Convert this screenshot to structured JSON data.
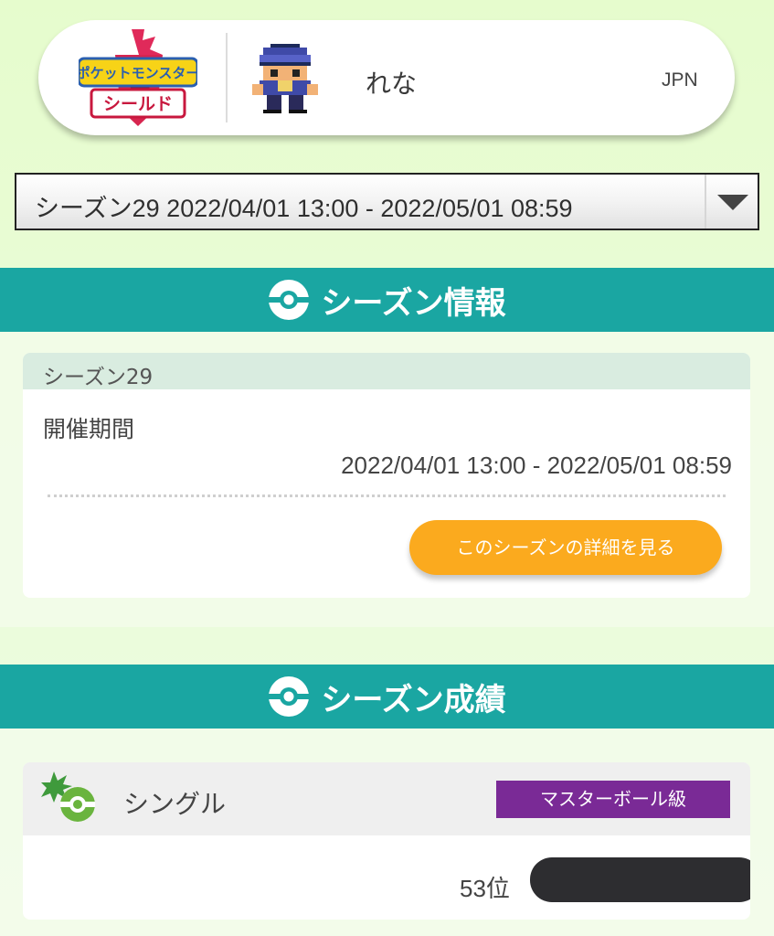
{
  "profile": {
    "game_logo_text_line1": "ポケットモンスター",
    "game_logo_text_line2": "シールド",
    "trainer_name": "れな",
    "region": "JPN"
  },
  "season_select": {
    "selected": "シーズン29 2022/04/01 13:00 - 2022/05/01 08:59"
  },
  "season_info": {
    "title": "シーズン情報",
    "card_title": "シーズン29",
    "period_label": "開催期間",
    "period_value": "2022/04/01 13:00 - 2022/05/01 08:59",
    "details_button": "このシーズンの詳細を見る"
  },
  "season_results": {
    "title": "シーズン成績",
    "battle_type": "シングル",
    "rank_class": "マスターボール級",
    "ranking": "53位"
  },
  "colors": {
    "teal": "#1aa6a2",
    "orange_button": "#fbaa1e",
    "purple_badge": "#7a2a96",
    "background": "#e6fccd"
  },
  "icons": {
    "game_logo": "pokemon-shield-logo",
    "trainer_avatar": "pixel-trainer-avatar",
    "section_icon": "poke-ball-icon",
    "battle_icon": "single-battle-icon",
    "dropdown": "triangle-down-icon"
  }
}
